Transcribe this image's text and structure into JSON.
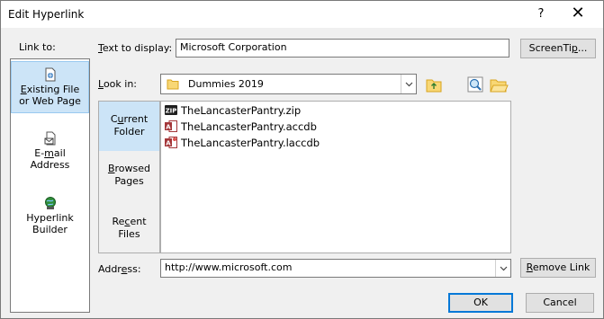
{
  "dialog": {
    "title": "Edit Hyperlink",
    "help_glyph": "?",
    "close_glyph": "✕"
  },
  "link_to": {
    "label": "Link to:",
    "items": [
      {
        "line1_u": "E",
        "line1": "xisting File",
        "line2": "or Web Page",
        "icon": "existing-file-icon"
      },
      {
        "line1": "E-",
        "line1_u": "m",
        "line1_rest": "ail",
        "line2": "Address",
        "icon": "email-icon"
      },
      {
        "line1": "Hyperlink",
        "line2": "Builder",
        "icon": "hyperlink-builder-icon"
      }
    ]
  },
  "text_to_display": {
    "label_u": "T",
    "label": "ext to display:",
    "value": "Microsoft Corporation"
  },
  "screentip_button": {
    "label": "ScreenTi",
    "label_u": "p",
    "label_rest": "..."
  },
  "look_in": {
    "label_u": "L",
    "label": "ook in:",
    "value": "Dummies 2019"
  },
  "places": [
    {
      "line1": "C",
      "line1_u": "u",
      "line1_rest": "rrent",
      "line2": "Folder"
    },
    {
      "line1_u": "B",
      "line1": "rowsed",
      "line2": "Pages"
    },
    {
      "line1": "Re",
      "line1_u": "c",
      "line1_rest": "ent",
      "line2": "Files"
    }
  ],
  "files": [
    {
      "name": "TheLancasterPantry.zip",
      "icon": "zip-file-icon"
    },
    {
      "name": "TheLancasterPantry.accdb",
      "icon": "access-file-icon"
    },
    {
      "name": "TheLancasterPantry.laccdb",
      "icon": "access-lock-file-icon"
    }
  ],
  "address": {
    "label": "Addr",
    "label_u": "e",
    "label_rest": "ss:",
    "value": "http://www.microsoft.com"
  },
  "remove_link_button": {
    "label_u": "R",
    "label": "emove Link"
  },
  "ok_button": {
    "label": "OK"
  },
  "cancel_button": {
    "label": "Cancel"
  }
}
